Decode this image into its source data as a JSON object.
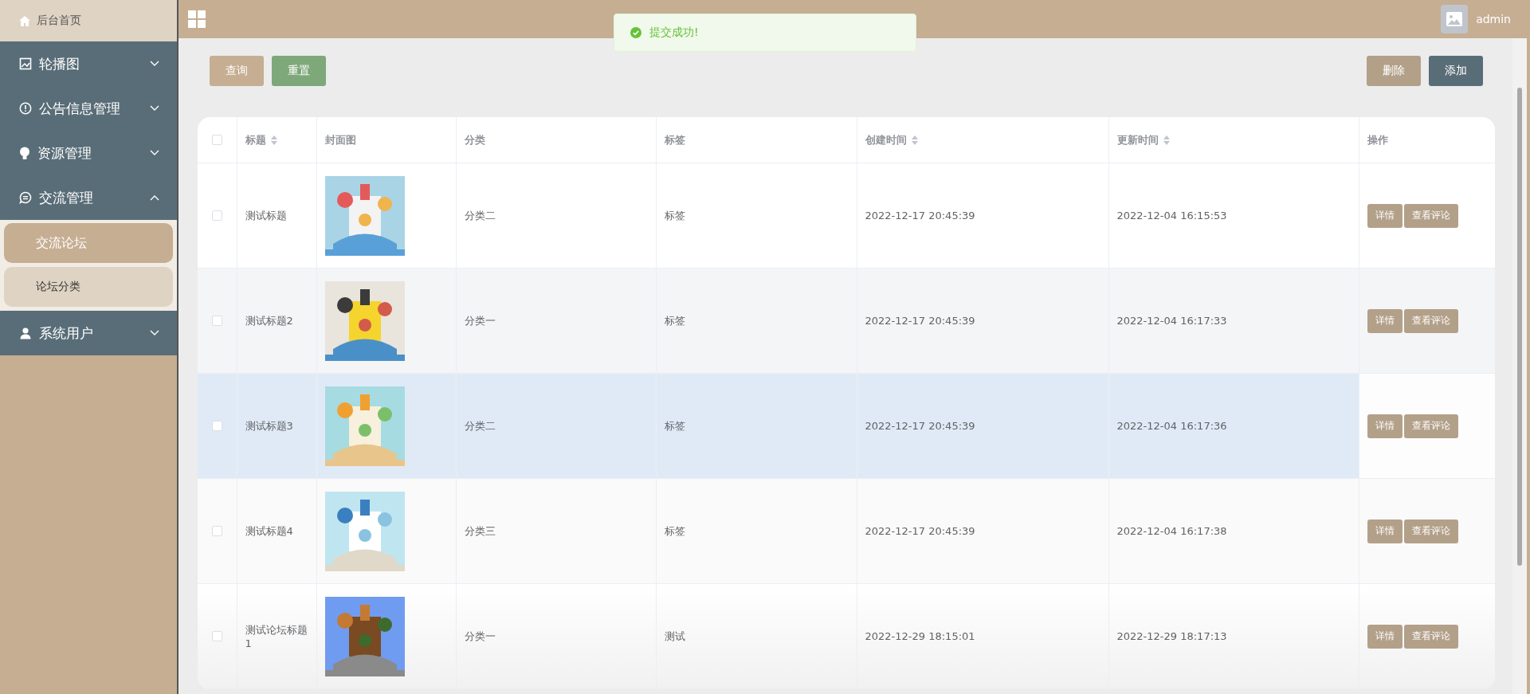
{
  "sidebar": {
    "home": {
      "label": "后台首页"
    },
    "menus": [
      {
        "label": "轮播图",
        "expanded": false
      },
      {
        "label": "公告信息管理",
        "expanded": false
      },
      {
        "label": "资源管理",
        "expanded": false
      },
      {
        "label": "交流管理",
        "expanded": true,
        "children": [
          {
            "label": "交流论坛",
            "selected": true
          },
          {
            "label": "论坛分类",
            "selected": false
          }
        ]
      },
      {
        "label": "系统用户",
        "expanded": false
      }
    ]
  },
  "topbar": {
    "user": "admin"
  },
  "toast": {
    "message": "提交成功!"
  },
  "toolbar": {
    "left_buttons": [
      "查询",
      "重置"
    ],
    "right_buttons": [
      {
        "label": "删除",
        "disabled": true
      },
      {
        "label": "添加",
        "disabled": false
      }
    ]
  },
  "table": {
    "all_checked": false,
    "columns": [
      {
        "label": "标题",
        "sortable": true
      },
      {
        "label": "封面图",
        "sortable": false
      },
      {
        "label": "分类",
        "sortable": false
      },
      {
        "label": "标签",
        "sortable": false
      },
      {
        "label": "创建时间",
        "sortable": true
      },
      {
        "label": "更新时间",
        "sortable": true
      },
      {
        "label": "操作",
        "sortable": false
      }
    ],
    "rows": [
      {
        "checked": false,
        "highlighted": false,
        "title": "测试标题",
        "category": "分类二",
        "tag": "标签",
        "created": "2022-12-17 20:45:39",
        "updated": "2022-12-04 16:15:53",
        "actions": [
          "详情",
          "查看评论"
        ]
      },
      {
        "checked": false,
        "highlighted": false,
        "title": "测试标题2",
        "category": "分类一",
        "tag": "标签",
        "created": "2022-12-17 20:45:39",
        "updated": "2022-12-04 16:17:33",
        "actions": [
          "详情",
          "查看评论"
        ]
      },
      {
        "checked": false,
        "highlighted": true,
        "title": "测试标题3",
        "category": "分类二",
        "tag": "标签",
        "created": "2022-12-17 20:45:39",
        "updated": "2022-12-04 16:17:36",
        "actions": [
          "详情",
          "查看评论"
        ]
      },
      {
        "checked": false,
        "highlighted": false,
        "title": "测试标题4",
        "category": "分类三",
        "tag": "标签",
        "created": "2022-12-17 20:45:39",
        "updated": "2022-12-04 16:17:38",
        "actions": [
          "详情",
          "查看评论"
        ]
      },
      {
        "checked": false,
        "highlighted": false,
        "title": "测试论坛标题1",
        "category": "分类一",
        "tag": "测试",
        "created": "2022-12-29 18:15:01",
        "updated": "2022-12-29 18:17:13",
        "actions": [
          "详情",
          "查看评论"
        ]
      }
    ]
  }
}
